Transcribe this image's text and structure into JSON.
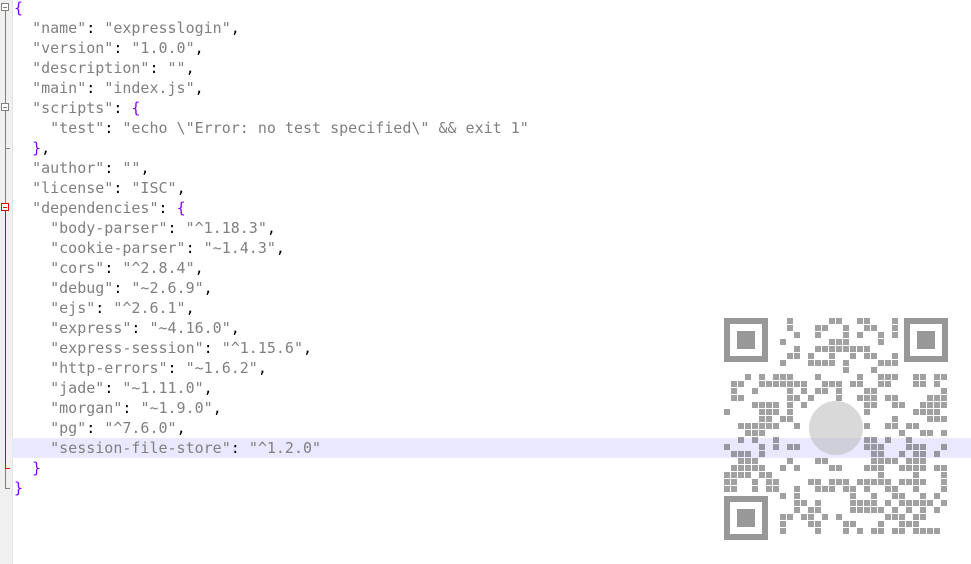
{
  "editor": {
    "current_line": 22,
    "lines": [
      [
        {
          "t": "{",
          "c": "brace"
        }
      ],
      [
        {
          "t": "  "
        },
        {
          "t": "\"name\"",
          "c": "key"
        },
        {
          "t": ": ",
          "c": "punc"
        },
        {
          "t": "\"expresslogin\"",
          "c": "str"
        },
        {
          "t": ",",
          "c": "punc"
        }
      ],
      [
        {
          "t": "  "
        },
        {
          "t": "\"version\"",
          "c": "key"
        },
        {
          "t": ": ",
          "c": "punc"
        },
        {
          "t": "\"1.0.0\"",
          "c": "str"
        },
        {
          "t": ",",
          "c": "punc"
        }
      ],
      [
        {
          "t": "  "
        },
        {
          "t": "\"description\"",
          "c": "key"
        },
        {
          "t": ": ",
          "c": "punc"
        },
        {
          "t": "\"\"",
          "c": "str"
        },
        {
          "t": ",",
          "c": "punc"
        }
      ],
      [
        {
          "t": "  "
        },
        {
          "t": "\"main\"",
          "c": "key"
        },
        {
          "t": ": ",
          "c": "punc"
        },
        {
          "t": "\"index.js\"",
          "c": "str"
        },
        {
          "t": ",",
          "c": "punc"
        }
      ],
      [
        {
          "t": "  "
        },
        {
          "t": "\"scripts\"",
          "c": "key"
        },
        {
          "t": ": ",
          "c": "punc"
        },
        {
          "t": "{",
          "c": "brace"
        }
      ],
      [
        {
          "t": "    "
        },
        {
          "t": "\"test\"",
          "c": "key"
        },
        {
          "t": ": ",
          "c": "punc"
        },
        {
          "t": "\"echo \\\"Error: no test specified\\\" && exit 1\"",
          "c": "str"
        }
      ],
      [
        {
          "t": "  "
        },
        {
          "t": "}",
          "c": "brace"
        },
        {
          "t": ",",
          "c": "punc"
        }
      ],
      [
        {
          "t": "  "
        },
        {
          "t": "\"author\"",
          "c": "key"
        },
        {
          "t": ": ",
          "c": "punc"
        },
        {
          "t": "\"\"",
          "c": "str"
        },
        {
          "t": ",",
          "c": "punc"
        }
      ],
      [
        {
          "t": "  "
        },
        {
          "t": "\"license\"",
          "c": "key"
        },
        {
          "t": ": ",
          "c": "punc"
        },
        {
          "t": "\"ISC\"",
          "c": "str"
        },
        {
          "t": ",",
          "c": "punc"
        }
      ],
      [
        {
          "t": "  "
        },
        {
          "t": "\"dependencies\"",
          "c": "key"
        },
        {
          "t": ": ",
          "c": "punc"
        },
        {
          "t": "{",
          "c": "brace"
        }
      ],
      [
        {
          "t": "    "
        },
        {
          "t": "\"body-parser\"",
          "c": "key"
        },
        {
          "t": ": ",
          "c": "punc"
        },
        {
          "t": "\"^1.18.3\"",
          "c": "str"
        },
        {
          "t": ",",
          "c": "punc"
        }
      ],
      [
        {
          "t": "    "
        },
        {
          "t": "\"cookie-parser\"",
          "c": "key"
        },
        {
          "t": ": ",
          "c": "punc"
        },
        {
          "t": "\"~1.4.3\"",
          "c": "str"
        },
        {
          "t": ",",
          "c": "punc"
        }
      ],
      [
        {
          "t": "    "
        },
        {
          "t": "\"cors\"",
          "c": "key"
        },
        {
          "t": ": ",
          "c": "punc"
        },
        {
          "t": "\"^2.8.4\"",
          "c": "str"
        },
        {
          "t": ",",
          "c": "punc"
        }
      ],
      [
        {
          "t": "    "
        },
        {
          "t": "\"debug\"",
          "c": "key"
        },
        {
          "t": ": ",
          "c": "punc"
        },
        {
          "t": "\"~2.6.9\"",
          "c": "str"
        },
        {
          "t": ",",
          "c": "punc"
        }
      ],
      [
        {
          "t": "    "
        },
        {
          "t": "\"ejs\"",
          "c": "key"
        },
        {
          "t": ": ",
          "c": "punc"
        },
        {
          "t": "\"^2.6.1\"",
          "c": "str"
        },
        {
          "t": ",",
          "c": "punc"
        }
      ],
      [
        {
          "t": "    "
        },
        {
          "t": "\"express\"",
          "c": "key"
        },
        {
          "t": ": ",
          "c": "punc"
        },
        {
          "t": "\"~4.16.0\"",
          "c": "str"
        },
        {
          "t": ",",
          "c": "punc"
        }
      ],
      [
        {
          "t": "    "
        },
        {
          "t": "\"express-session\"",
          "c": "key"
        },
        {
          "t": ": ",
          "c": "punc"
        },
        {
          "t": "\"^1.15.6\"",
          "c": "str"
        },
        {
          "t": ",",
          "c": "punc"
        }
      ],
      [
        {
          "t": "    "
        },
        {
          "t": "\"http-errors\"",
          "c": "key"
        },
        {
          "t": ": ",
          "c": "punc"
        },
        {
          "t": "\"~1.6.2\"",
          "c": "str"
        },
        {
          "t": ",",
          "c": "punc"
        }
      ],
      [
        {
          "t": "    "
        },
        {
          "t": "\"jade\"",
          "c": "key"
        },
        {
          "t": ": ",
          "c": "punc"
        },
        {
          "t": "\"~1.11.0\"",
          "c": "str"
        },
        {
          "t": ",",
          "c": "punc"
        }
      ],
      [
        {
          "t": "    "
        },
        {
          "t": "\"morgan\"",
          "c": "key"
        },
        {
          "t": ": ",
          "c": "punc"
        },
        {
          "t": "\"~1.9.0\"",
          "c": "str"
        },
        {
          "t": ",",
          "c": "punc"
        }
      ],
      [
        {
          "t": "    "
        },
        {
          "t": "\"pg\"",
          "c": "key"
        },
        {
          "t": ": ",
          "c": "punc"
        },
        {
          "t": "\"^7.6.0\"",
          "c": "str"
        },
        {
          "t": ",",
          "c": "punc"
        }
      ],
      [
        {
          "t": "    "
        },
        {
          "t": "\"session-file-store\"",
          "c": "key"
        },
        {
          "t": ": ",
          "c": "punc"
        },
        {
          "t": "\"^1.2.0\"",
          "c": "str"
        }
      ],
      [
        {
          "t": "  "
        },
        {
          "t": "}",
          "c": "brace"
        }
      ],
      [
        {
          "t": "}",
          "c": "brace"
        }
      ]
    ]
  },
  "colors": {
    "key_string": "#808080",
    "punctuation": "#000000",
    "brace": "#8000ff",
    "current_line_bg": "#e8e8ff",
    "fold_marker": "#808080",
    "fold_marker_active": "#e00000"
  },
  "watermark": {
    "icon": "qr-code-icon"
  }
}
